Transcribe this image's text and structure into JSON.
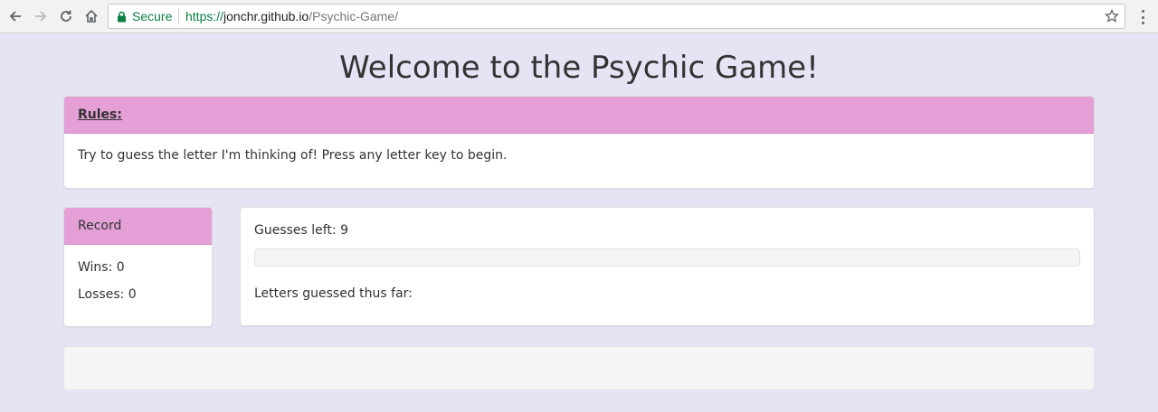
{
  "browser": {
    "secure_label": "Secure",
    "url_scheme": "https://",
    "url_host": "jonchr.github.io",
    "url_path": "/Psychic-Game/",
    "icons": [
      "back-arrow-icon",
      "forward-arrow-icon",
      "reload-icon",
      "home-icon",
      "lock-icon",
      "star-icon",
      "menu-dots-icon"
    ]
  },
  "page": {
    "title": "Welcome to the Psychic Game!"
  },
  "rules": {
    "heading": "Rules:",
    "text": "Try to guess the letter I'm thinking of! Press any letter key to begin."
  },
  "record": {
    "heading": "Record",
    "wins": "Wins: 0",
    "losses": "Losses: 0"
  },
  "game": {
    "guesses_left": "Guesses left: 9",
    "progress_fraction": 0,
    "letters_guessed": "Letters guessed thus far:"
  },
  "colors": {
    "background": "#e6e4f4",
    "panel_heading": "#e39fd6",
    "secure_green": "#0b8043"
  }
}
